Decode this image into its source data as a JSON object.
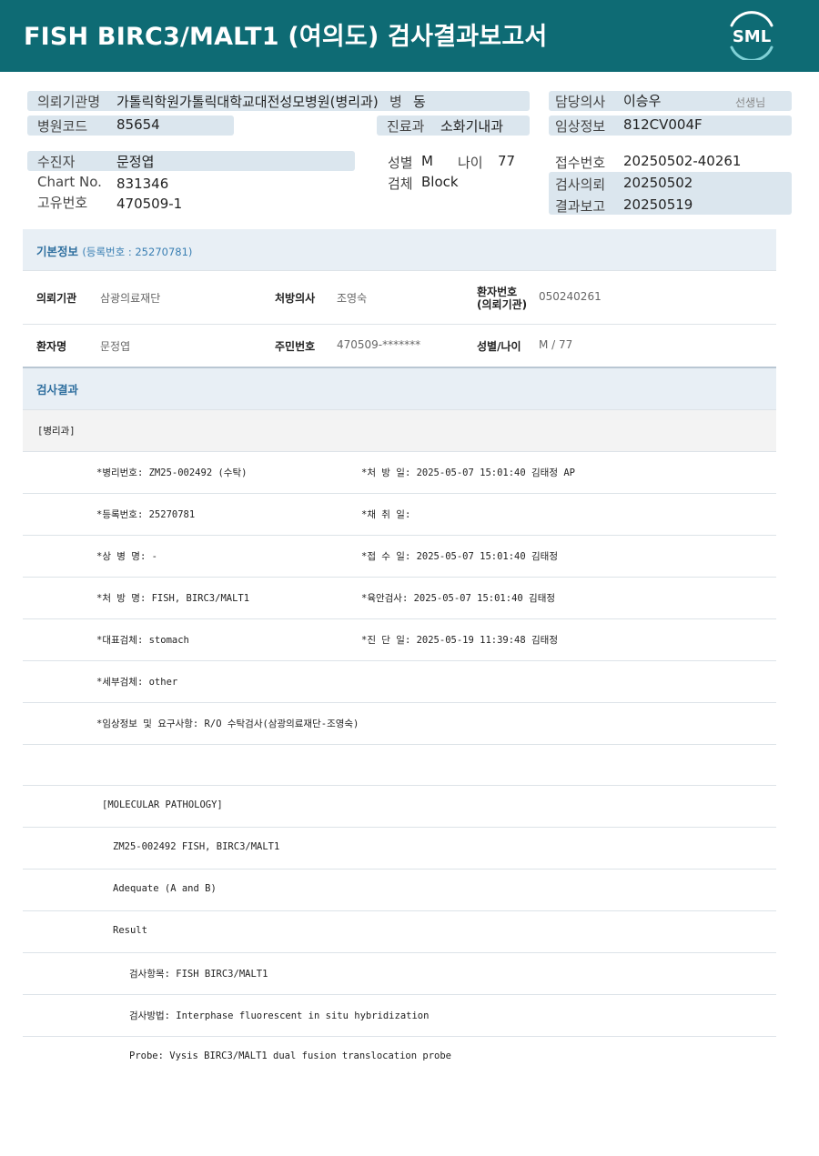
{
  "header": {
    "title": "FISH  BIRC3/MALT1  (여의도) 검사결과보고서",
    "logo_text": "SML",
    "brand_color": "#0e6b74"
  },
  "info": {
    "institution_label": "의뢰기관명",
    "institution_value": "가톨릭학원가톨릭대학교대전성모병원(병리과)",
    "ward_label": "병",
    "ward_value": "동",
    "doctor_label": "담당의사",
    "doctor_value": "이승우",
    "doctor_suffix": "선생님",
    "hospital_code_label": "병원코드",
    "hospital_code_value": "85654",
    "dept_label": "진료과",
    "dept_value": "소화기내과",
    "clinical_label": "임상정보",
    "clinical_value": "812CV004F",
    "patient_label": "수진자",
    "patient_value": "문정엽",
    "sex_label": "성별",
    "sex_value": "M",
    "age_label": "나이",
    "age_value": "77",
    "receipt_label": "접수번호",
    "receipt_value": "20250502-40261",
    "chart_label": "Chart No.",
    "chart_value": "831346",
    "specimen_label": "검체",
    "specimen_value": "Block",
    "request_label": "검사의뢰",
    "request_value": "20250502",
    "unique_label": "고유번호",
    "unique_value": "470509-1",
    "report_label": "결과보고",
    "report_value": "20250519"
  },
  "basic": {
    "title": "기본정보",
    "sub": "(등록번호 : 25270781)",
    "row1": {
      "k1": "의뢰기관",
      "v1": "삼광의료재단",
      "k2": "처방의사",
      "v2": "조영숙",
      "k3a": "환자번호",
      "k3b": "(의뢰기관)",
      "v3": "050240261"
    },
    "row2": {
      "k1": "환자명",
      "v1": "문정엽",
      "k2": "주민번호",
      "v2": "470509-*******",
      "k3": "성별/나이",
      "v3": "M / 77"
    }
  },
  "results": {
    "title": "검사결과",
    "dept": "[병리과]",
    "rows": [
      {
        "left": "*병리번호: ZM25-002492 (수탁)",
        "right": "*처 방 일: 2025-05-07 15:01:40  김태정 AP"
      },
      {
        "left": "*등록번호: 25270781",
        "right": "*채 취 일:"
      },
      {
        "left": "*상 병 명: -",
        "right": "*접 수 일: 2025-05-07 15:01:40  김태정"
      },
      {
        "left": "*처 방 명: FISH, BIRC3/MALT1",
        "right": "*육안검사: 2025-05-07 15:01:40  김태정"
      },
      {
        "left": "*대표검체: stomach",
        "right": "*진 단 일: 2025-05-19 11:39:48  김태정"
      },
      {
        "left": "*세부검체: other",
        "right": ""
      },
      {
        "left": "*임상정보 및 요구사항: R/O 수탁검사(삼광의료재단-조영숙)",
        "right": ""
      }
    ],
    "mol_title": "[MOLECULAR PATHOLOGY]",
    "mol_id": "ZM25-002492     FISH, BIRC3/MALT1",
    "adequate": "Adequate (A and B)",
    "result": "Result",
    "item": "검사항목: FISH BIRC3/MALT1",
    "method": "검사방법: Interphase fluorescent in situ hybridization",
    "probe": "Probe: Vysis BIRC3/MALT1 dual fusion translocation probe"
  }
}
